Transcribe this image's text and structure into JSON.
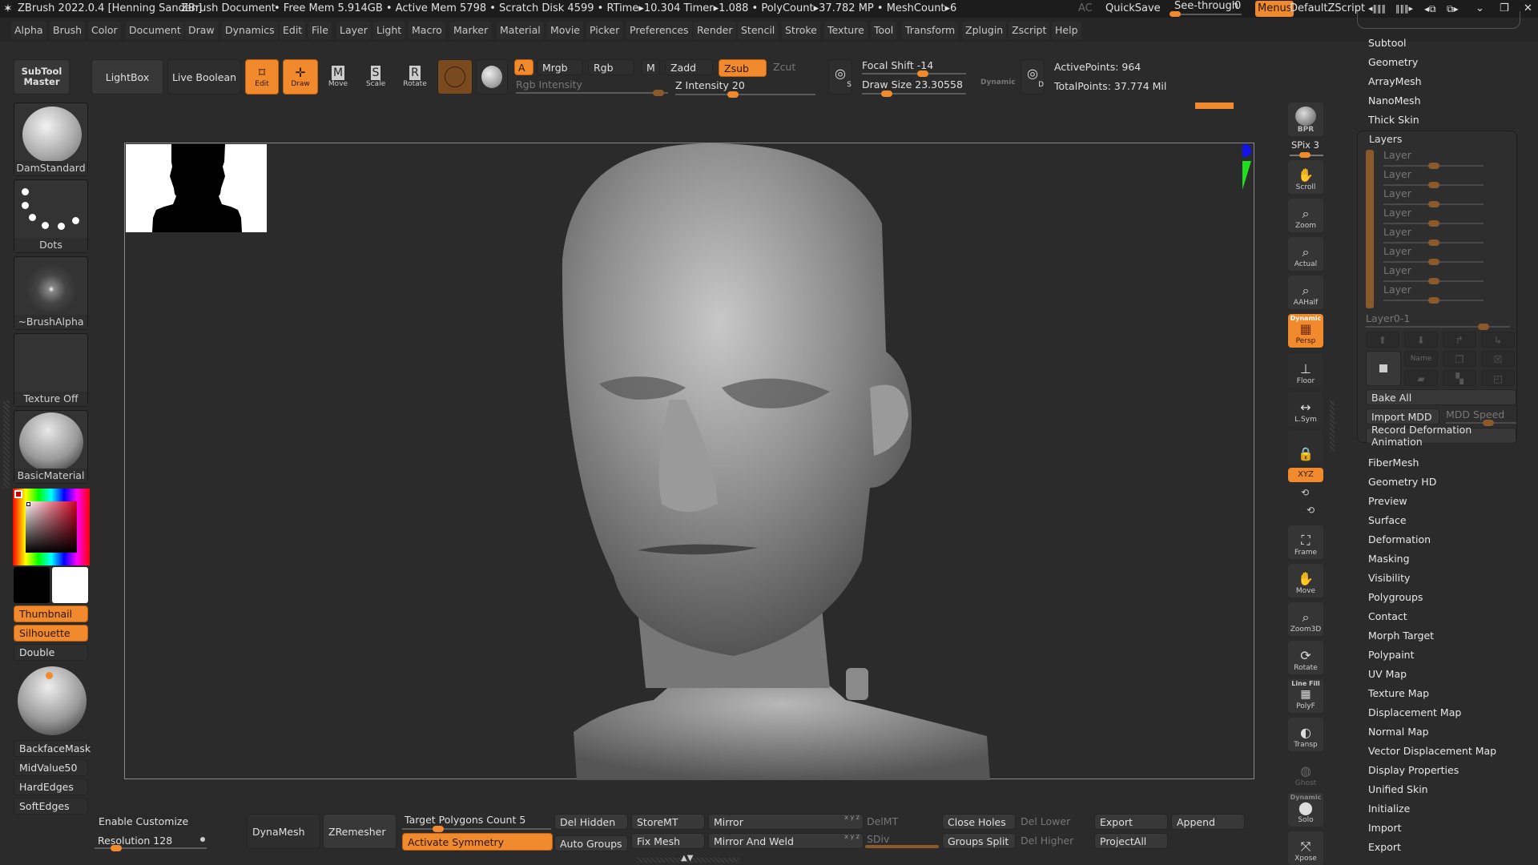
{
  "titlebar": {
    "app": "ZBrush 2022.0.4 [Henning Sanden]",
    "document": "ZBrush Document",
    "stats": "• Free Mem 5.914GB • Active Mem 5798 • Scratch Disk 4599 • RTime▸10.304 Timer▸1.088 • PolyCount▸37.782 MP • MeshCount▸6",
    "ac": "AC",
    "quicksave": "QuickSave",
    "seethrough": "See-through",
    "seethrough_value": "0",
    "menus": "Menus",
    "defaultzscript": "DefaultZScript",
    "win_controls": [
      "◂‖‖‖",
      "‖‖‖▸",
      "◂⧉",
      "⧉▸",
      "⌄",
      "❐",
      "✕"
    ]
  },
  "menubar": [
    "Alpha",
    "Brush",
    "Color",
    "Document",
    "Draw",
    "Dynamics",
    "Edit",
    "File",
    "Layer",
    "Light",
    "Macro",
    "Marker",
    "Material",
    "Movie",
    "Picker",
    "Preferences",
    "Render",
    "Stencil",
    "Stroke",
    "Texture",
    "Tool",
    "Transform",
    "Zplugin",
    "Zscript",
    "Help"
  ],
  "toolbar": {
    "subtool_master": "SubTool Master",
    "lightbox": "LightBox",
    "live_boolean": "Live Boolean",
    "edit": "Edit",
    "draw": "Draw",
    "move": "Move",
    "scale": "Scale",
    "rotate": "Rotate",
    "a": "A",
    "mrgb": "Mrgb",
    "rgb": "Rgb",
    "m": "M",
    "zadd": "Zadd",
    "zsub": "Zsub",
    "zcut": "Zcut",
    "rgb_intensity": "Rgb Intensity",
    "z_intensity": "Z Intensity 20",
    "focal_shift": "Focal Shift -14",
    "draw_size": "Draw Size 23.30558",
    "dynamic": "Dynamic",
    "active_points": "ActivePoints: 964",
    "total_points": "TotalPoints: 37.774 Mil",
    "z_intensity_value": 20,
    "focal_shift_value": -14,
    "draw_size_value": 23.30558
  },
  "left_shelf": {
    "brush": "DamStandard",
    "stroke": "Dots",
    "alpha": "~BrushAlpha",
    "texture": "Texture Off",
    "material": "BasicMaterial",
    "thumbnail": "Thumbnail",
    "silhouette": "Silhouette",
    "double": "Double",
    "backfacemask": "BackfaceMask",
    "midvalue": "MidValue50",
    "hardedges": "HardEdges",
    "softedges": "SoftEdges"
  },
  "right_shelf": {
    "bpr": "BPR",
    "spix": "SPix 3",
    "scroll": "Scroll",
    "zoom": "Zoom",
    "actual": "Actual",
    "aahalf": "AAHalf",
    "persp_dynamic": "Dynamic",
    "persp": "Persp",
    "floor": "Floor",
    "lsym": "L.Sym",
    "xyz": "XYZ",
    "frame": "Frame",
    "move": "Move",
    "zoom3d": "Zoom3D",
    "rotate": "Rotate",
    "linefill": "Line Fill",
    "polyf": "PolyF",
    "transp": "Transp",
    "ghost": "Ghost",
    "solo_dynamic": "Dynamic",
    "solo": "Solo",
    "xpose": "Xpose"
  },
  "tool_palette": {
    "top_items": [
      "Subtool",
      "Geometry",
      "ArrayMesh",
      "NanoMesh",
      "Thick Skin"
    ],
    "layers_title": "Layers",
    "layers": [
      "Layer",
      "Layer",
      "Layer",
      "Layer",
      "Layer",
      "Layer",
      "Layer",
      "Layer"
    ],
    "layer_name": "Layer0-1",
    "name_btn": "Name",
    "bake_all": "Bake All",
    "import_mdd": "Import MDD",
    "mdd_speed": "MDD Speed",
    "record_deformation": "Record Deformation Animation",
    "bottom_items": [
      "FiberMesh",
      "Geometry HD",
      "Preview",
      "Surface",
      "Deformation",
      "Masking",
      "Visibility",
      "Polygroups",
      "Contact",
      "Morph Target",
      "Polypaint",
      "UV Map",
      "Texture Map",
      "Displacement Map",
      "Normal Map",
      "Vector Displacement Map",
      "Display Properties",
      "Unified Skin",
      "Initialize",
      "Import",
      "Export"
    ]
  },
  "bottom_shelf": {
    "enable_customize": "Enable Customize",
    "resolution": "Resolution 128",
    "dynamesh": "DynaMesh",
    "zremesher": "ZRemesher",
    "target_polygons": "Target Polygons Count 5",
    "activate_symmetry": "Activate Symmetry",
    "del_hidden": "Del Hidden",
    "auto_groups": "Auto Groups",
    "storemt": "StoreMT",
    "fix_mesh": "Fix Mesh",
    "mirror": "Mirror",
    "mirror_and_weld": "Mirror And Weld",
    "xyz_small": "x y z",
    "delmt": "DelMT",
    "sdiv": "SDiv",
    "close_holes": "Close Holes",
    "groups_split": "Groups Split",
    "del_lower": "Del Lower",
    "del_higher": "Del Higher",
    "export": "Export",
    "projectall": "ProjectAll",
    "append": "Append"
  },
  "colors": {
    "accent": "#f08a2c",
    "background": "#2b2b2b",
    "panel": "#383838"
  }
}
